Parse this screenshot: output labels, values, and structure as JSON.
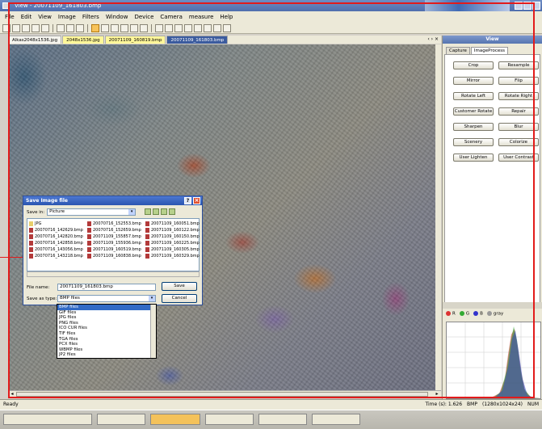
{
  "window": {
    "title": "View - 20071109_161803.bmp"
  },
  "menu": [
    "File",
    "Edit",
    "View",
    "Image",
    "Filters",
    "Window",
    "Device",
    "Camera",
    "measure",
    "Help"
  ],
  "doc_tabs": [
    {
      "label": "Alkas2048x1536.jpg"
    },
    {
      "label": "2048x1536.jpg"
    },
    {
      "label": "20071109_160819.bmp"
    },
    {
      "label": "20071109_161803.bmp"
    }
  ],
  "doc_tabs_nav": "‹ › ×",
  "panel": {
    "title": "View",
    "tabs": [
      "Capture",
      "ImageProcess"
    ],
    "buttons": [
      [
        "Crop",
        "Resample"
      ],
      [
        "Mirror",
        "Flip"
      ],
      [
        "Rotate Left",
        "Rotate Right"
      ],
      [
        "Customer Rotate",
        "Repair"
      ],
      [
        "Sharpen",
        "Blur"
      ],
      [
        "Scenery",
        "Colorize"
      ],
      [
        "User Lighten",
        "User Contrast"
      ]
    ],
    "histogram_channels": [
      "R",
      "G",
      "B",
      "gray"
    ]
  },
  "status": {
    "left": "Ready",
    "time": "Time (s): 1.626",
    "format": "BMP",
    "size": "(1280x1024x24)",
    "num": "NUM"
  },
  "dialog": {
    "title": "Save Image file",
    "save_in_label": "Save in:",
    "save_in_value": "Picture",
    "files_col1": [
      "JPG",
      "20070716_142629.bmp",
      "20070716_142820.bmp",
      "20070716_142858.bmp",
      "20070716_143056.bmp",
      "20070716_143218.bmp"
    ],
    "files_col2": [
      "20070716_152553.bmp",
      "20070716_152659.bmp",
      "20071109_155857.bmp",
      "20071109_155936.bmp",
      "20071109_160519.bmp",
      "20071109_160838.bmp"
    ],
    "files_col3": [
      "20071109_160051.bmp",
      "20071109_160122.bmp",
      "20071109_160150.bmp",
      "20071109_160225.bmp",
      "20071109_160305.bmp",
      "20071109_160329.bmp"
    ],
    "file_name_label": "File name:",
    "file_name_value": "20071109_161803.bmp",
    "save_as_label": "Save as type:",
    "save_as_value": "BMP files",
    "save_button": "Save",
    "cancel_button": "Cancel",
    "type_options": [
      "BMP files",
      "GIF files",
      "JPG files",
      "PNG files",
      "ICO CUR files",
      "TIF files",
      "TGA files",
      "PCX files",
      "WBMP files",
      "JP2 files"
    ]
  },
  "colors": {
    "highlight_frame": "#e21b1b",
    "title_bar": "#4f6fae",
    "selection": "#316ac5"
  }
}
